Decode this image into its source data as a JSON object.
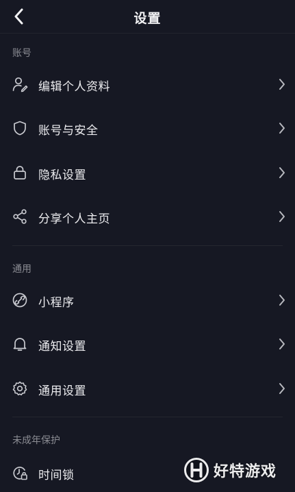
{
  "header": {
    "title": "设置",
    "back_icon": "chevron-left-icon"
  },
  "sections": [
    {
      "label": "账号",
      "items": [
        {
          "label": "编辑个人资料",
          "icon": "user-edit-icon"
        },
        {
          "label": "账号与安全",
          "icon": "shield-icon"
        },
        {
          "label": "隐私设置",
          "icon": "lock-icon"
        },
        {
          "label": "分享个人主页",
          "icon": "share-icon"
        }
      ]
    },
    {
      "label": "通用",
      "items": [
        {
          "label": "小程序",
          "icon": "mini-program-icon"
        },
        {
          "label": "通知设置",
          "icon": "bell-icon"
        },
        {
          "label": "通用设置",
          "icon": "gear-icon"
        }
      ]
    },
    {
      "label": "未成年保护",
      "items": [
        {
          "label": "时间锁",
          "icon": "time-lock-icon"
        }
      ]
    }
  ],
  "watermark": {
    "text": "好特游戏",
    "badge": "H"
  },
  "colors": {
    "background": "#161823",
    "text": "#ececef",
    "muted": "#8b8c93",
    "divider": "#25272f"
  }
}
